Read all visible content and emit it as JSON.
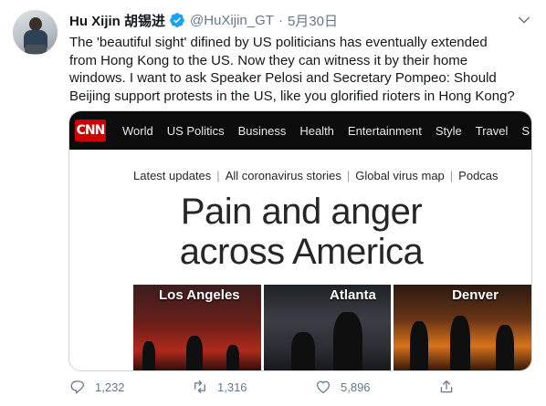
{
  "author": {
    "name": "Hu Xijin 胡锡进",
    "handle": "@HuXijin_GT",
    "separator": "·",
    "date": "5月30日",
    "verified": true
  },
  "tweet": {
    "lines": [
      "The 'beautiful sight' difined by US politicians has eventually extended",
      "from Hong Kong to the US. Now they can witness it by their home",
      "windows. I want to ask Speaker Pelosi and Secretary Pompeo: Should",
      "Beijing support protests in the US, like you glorified rioters in Hong Kong?"
    ]
  },
  "media": {
    "logo": "CNN",
    "nav": [
      "World",
      "US Politics",
      "Business",
      "Health",
      "Entertainment",
      "Style",
      "Travel",
      "S"
    ],
    "sub_nav": [
      "Latest updates",
      "All coronavirus stories",
      "Global virus map",
      "Podcas"
    ],
    "headline": [
      "Pain and anger",
      "across America"
    ],
    "photos": [
      {
        "title": "Los Angeles"
      },
      {
        "title": "Atlanta"
      },
      {
        "title": "Denver"
      }
    ]
  },
  "actions": {
    "reply_count": "1,232",
    "retweet_count": "1,316",
    "like_count": "5,896"
  },
  "colors": {
    "verified": "#1da1f2",
    "muted": "#657786",
    "cnn_red": "#cc0000"
  },
  "icons": [
    "verified-badge-icon",
    "chevron-down-icon",
    "reply-icon",
    "retweet-icon",
    "like-icon",
    "share-icon"
  ]
}
